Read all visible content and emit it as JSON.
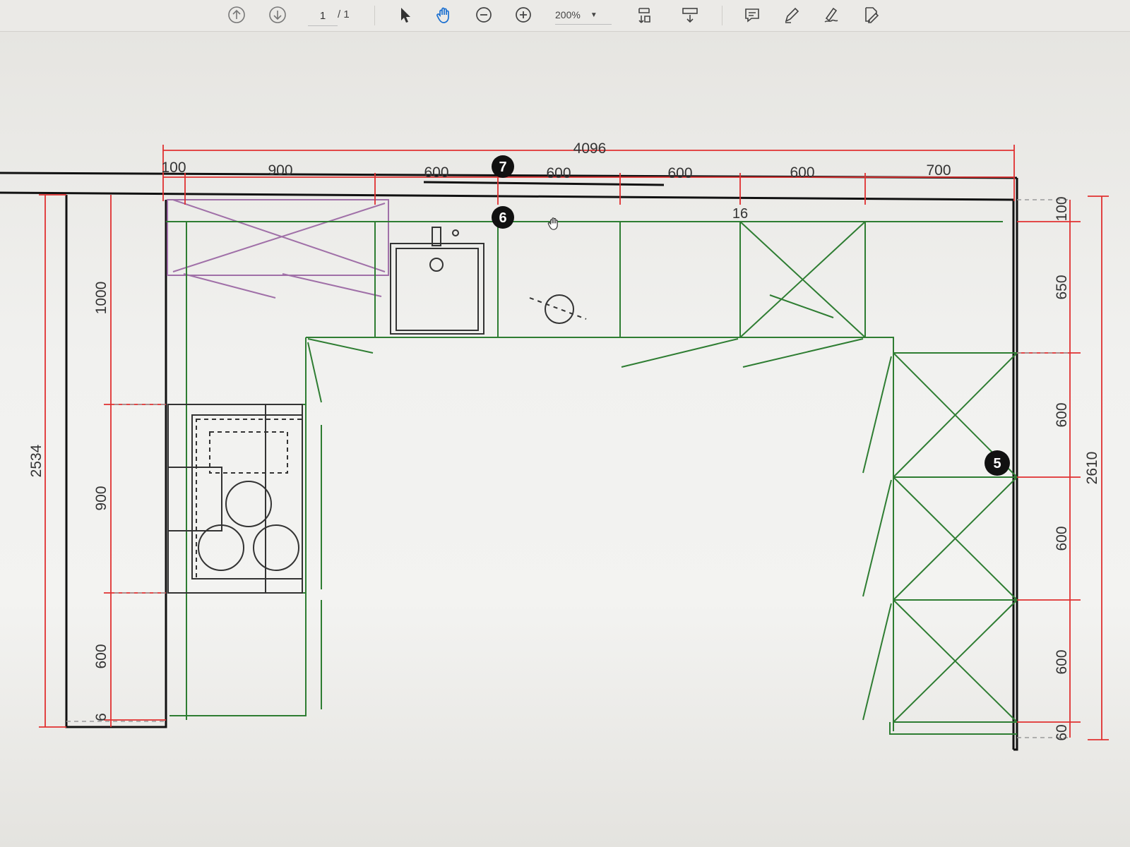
{
  "toolbar": {
    "page_current": "1",
    "page_total": "/ 1",
    "zoom": "200%",
    "icons": [
      "arrow-up-circle-icon",
      "arrow-down-circle-icon",
      "pointer-icon",
      "hand-icon",
      "zoom-out-icon",
      "zoom-in-icon",
      "zoom-dropdown-icon",
      "fit-page-icon",
      "scroll-mode-icon",
      "comment-icon",
      "pen-icon",
      "sign-icon",
      "edit-pdf-icon"
    ]
  },
  "drawing": {
    "top_dims": {
      "overall": "4096",
      "segments": [
        "100",
        "900",
        "600",
        "600",
        "600",
        "600",
        "700"
      ]
    },
    "left_dims": {
      "overall": "2534",
      "segments": [
        "1000",
        "900",
        "600",
        "6"
      ]
    },
    "right_dims": {
      "overall": "2610",
      "segments": [
        "100",
        "650",
        "600",
        "600",
        "600",
        "60"
      ]
    },
    "markers": [
      "7",
      "6",
      "16",
      "5"
    ],
    "colors": {
      "dimension": "#e03030",
      "cabinet": "#2e7d32",
      "wall_cabinet": "#a070a8",
      "wall": "#111111"
    }
  }
}
